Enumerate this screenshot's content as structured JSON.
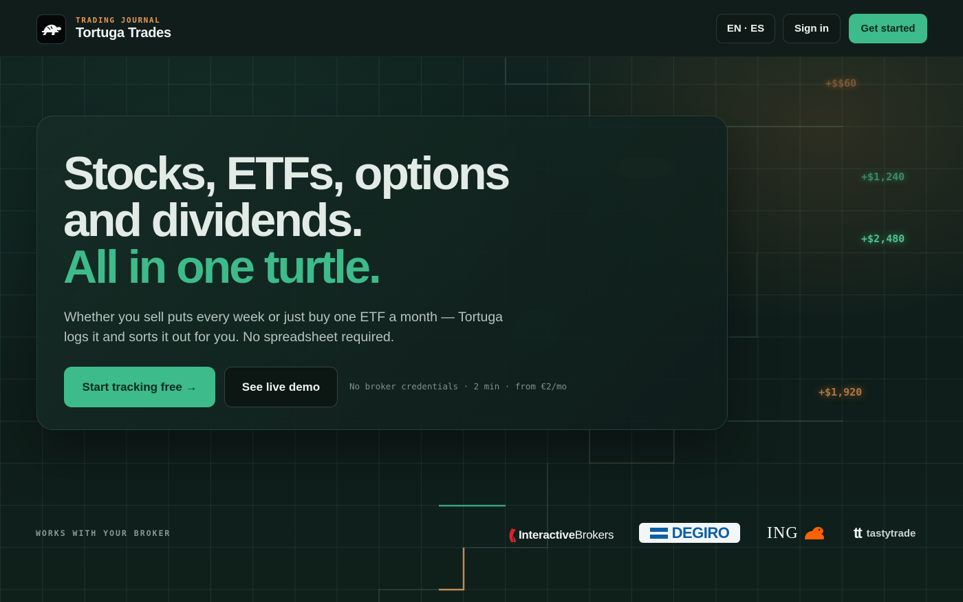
{
  "header": {
    "kicker": "TRADING JOURNAL",
    "brand": "Tortuga Trades",
    "lang_toggle": "EN · ES",
    "sign_in": "Sign in",
    "get_started": "Get started"
  },
  "hero": {
    "headline_line1": "Stocks, ETFs, options",
    "headline_line2": "and dividends.",
    "headline_accent": "All in one turtle.",
    "subtitle": "Whether you sell puts every week or just buy one ETF a month — Tortuga logs it and sorts it out for you. No spreadsheet required.",
    "cta_primary": "Start tracking free →",
    "cta_secondary": "See live demo",
    "fineprint": "No broker credentials · 2 min · from €2/mo"
  },
  "background_pnl": [
    {
      "value": "+$$60",
      "tone": "orange"
    },
    {
      "value": "+$1,240",
      "tone": "green"
    },
    {
      "value": "+$2,480",
      "tone": "green"
    },
    {
      "value": "+$1,920",
      "tone": "orange"
    }
  ],
  "brokers": {
    "label": "WORKS WITH YOUR BROKER",
    "interactive_brokers": {
      "part1": "Interactive",
      "part2": "Brokers"
    },
    "degiro": "DEGIRO",
    "ing": "ING",
    "tastytrade": {
      "mark": "tt",
      "name": "tastytrade"
    }
  },
  "colors": {
    "accent": "#3dbb8a",
    "accent_orange": "#e59a55",
    "background": "#0e1a17",
    "degiro_blue": "#0b5ea8",
    "ib_red": "#d3232f",
    "ing_orange": "#ff6200"
  },
  "icons": {
    "logo": "turtle-icon",
    "cta_arrow": "arrow-right-icon",
    "ib_mark": "interactive-brokers-logo",
    "degiro_mark": "degiro-logo",
    "ing_mark": "ing-lion-logo",
    "tasty_mark": "tastytrade-logo"
  }
}
